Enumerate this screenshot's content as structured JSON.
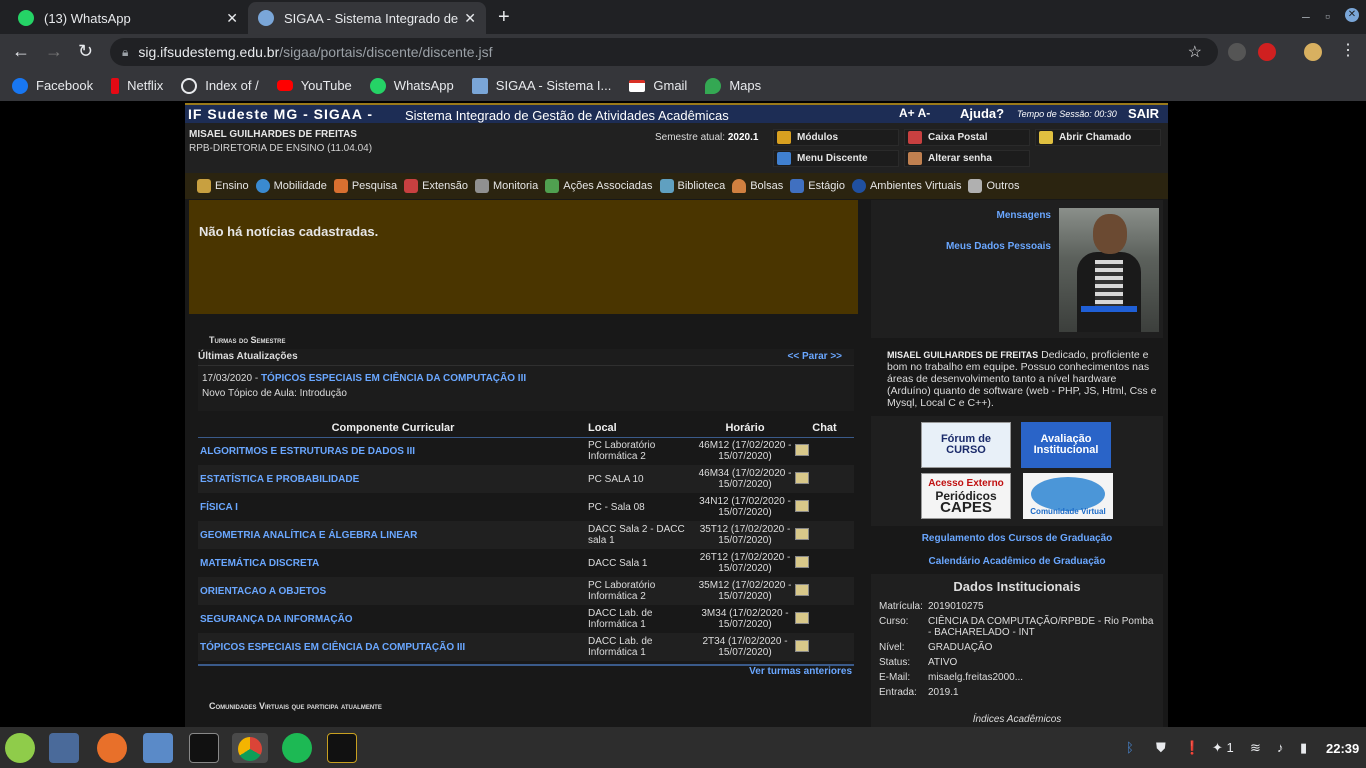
{
  "browser": {
    "tabs": [
      {
        "title": "(13) WhatsApp",
        "active": false
      },
      {
        "title": "SIGAA - Sistema Integrado de",
        "active": true
      }
    ],
    "url_host": "sig.ifsudestemg.edu.br",
    "url_path": "/sigaa/portais/discente/discente.jsf",
    "bookmarks": [
      "Facebook",
      "Netflix",
      "Index of /",
      "YouTube",
      "WhatsApp",
      "SIGAA - Sistema I...",
      "Gmail",
      "Maps"
    ]
  },
  "header": {
    "brand": "IF Sudeste MG - SIGAA -",
    "subtitle": "Sistema Integrado de Gestão de Atividades Acadêmicas",
    "font_controls": "A+ A-",
    "help": "Ajuda?",
    "session": "Tempo de Sessão: 00:30",
    "exit": "SAIR"
  },
  "user": {
    "name": "MISAEL GUILHARDES DE FREITAS",
    "dept": "RPB-DIRETORIA DE ENSINO (11.04.04)",
    "semester_label": "Semestre atual:",
    "semester": "2020.1",
    "buttons": [
      "Módulos",
      "Caixa Postal",
      "Abrir Chamado",
      "Menu Discente",
      "Alterar senha"
    ]
  },
  "menu": [
    "Ensino",
    "Mobilidade",
    "Pesquisa",
    "Extensão",
    "Monitoria",
    "Ações Associadas",
    "Biblioteca",
    "Bolsas",
    "Estágio",
    "Ambientes Virtuais",
    "Outros"
  ],
  "news": "Não há notícias cadastradas.",
  "turmas_title": "Turmas do Semestre",
  "updates": {
    "title": "Últimas Atualizações",
    "stop": "<< Parar >>",
    "date": "17/03/2020 - ",
    "course": "TÓPICOS ESPECIAIS EM CIÊNCIA DA COMPUTAÇÃO III",
    "topic": "Novo Tópico de Aula: Introdução"
  },
  "table": {
    "headers": [
      "Componente Curricular",
      "Local",
      "Horário",
      "Chat"
    ],
    "rows": [
      {
        "comp": "ALGORITMOS E ESTRUTURAS DE DADOS III",
        "local": "PC Laboratório Informática 2",
        "hor": "46M12 (17/02/2020 - 15/07/2020)"
      },
      {
        "comp": "ESTATÍSTICA E PROBABILIDADE",
        "local": "PC SALA 10",
        "hor": "46M34 (17/02/2020 - 15/07/2020)"
      },
      {
        "comp": "FÍSICA I",
        "local": "PC - Sala 08",
        "hor": "34N12 (17/02/2020 - 15/07/2020)"
      },
      {
        "comp": "GEOMETRIA ANALÍTICA E ÁLGEBRA LINEAR",
        "local": "DACC Sala 2 - DACC sala 1",
        "hor": "35T12 (17/02/2020 - 15/07/2020)"
      },
      {
        "comp": "MATEMÁTICA DISCRETA",
        "local": "DACC Sala 1",
        "hor": "26T12 (17/02/2020 - 15/07/2020)"
      },
      {
        "comp": "ORIENTACAO A OBJETOS",
        "local": "PC Laboratório Informática 2",
        "hor": "35M12 (17/02/2020 - 15/07/2020)"
      },
      {
        "comp": "SEGURANÇA DA INFORMAÇÃO",
        "local": "DACC Lab. de Informática 1",
        "hor": "3M34 (17/02/2020 - 15/07/2020)"
      },
      {
        "comp": "TÓPICOS ESPECIAIS EM CIÊNCIA DA COMPUTAÇÃO III",
        "local": "DACC Lab. de Informática 1",
        "hor": "2T34 (17/02/2020 - 15/07/2020)"
      }
    ],
    "older": "Ver turmas anteriores"
  },
  "communities_title": "Comunidades Virtuais que participa atualmente",
  "side": {
    "messages": "Mensagens",
    "my_data": "Meus Dados Pessoais",
    "bio_name": "MISAEL GUILHARDES DE FREITAS",
    "bio_text": " Dedicado, proficiente e bom no trabalho em equipe. Possuo conhecimentos nas áreas de desenvolvimento tanto a nível hardware (Arduíno) quanto de software (web - PHP, JS, Html, Css e Mysql, Local C e C++).",
    "banner_forum": "Fórum de CURSO",
    "banner_aval": "Avaliação Institucional",
    "banner_capes_top": "Acesso Externo",
    "banner_capes_mid": "Periódicos",
    "banner_capes_bot": "CAPES",
    "banner_comunidade": "Comunidade Virtual",
    "link_regulamento": "Regulamento dos Cursos de Graduação",
    "link_calendario": "Calendário Acadêmico de Graduação",
    "inst_title": "Dados Institucionais",
    "inst": [
      {
        "k": "Matrícula:",
        "v": "2019010275"
      },
      {
        "k": "Curso:",
        "v": "CIÊNCIA DA COMPUTAÇÃO/RPBDE - Rio Pomba - BACHARELADO - INT"
      },
      {
        "k": "Nível:",
        "v": "GRADUAÇÃO"
      },
      {
        "k": "Status:",
        "v": "ATIVO"
      },
      {
        "k": "E-Mail:",
        "v": "misaelg.freitas2000..."
      },
      {
        "k": "Entrada:",
        "v": "2019.1"
      }
    ],
    "indices": "Índices Acadêmicos"
  },
  "tray": {
    "notif_count": "1",
    "clock": "22:39"
  }
}
